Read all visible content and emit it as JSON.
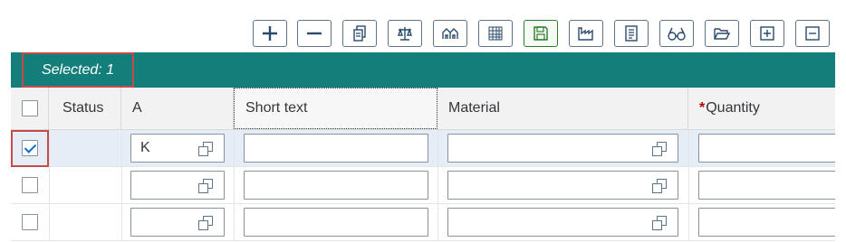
{
  "toolbar": {
    "buttons": [
      {
        "name": "add-row-button",
        "icon": "plus-icon"
      },
      {
        "name": "delete-row-button",
        "icon": "minus-icon"
      },
      {
        "name": "copy-button",
        "icon": "copy-icon"
      },
      {
        "name": "balance-button",
        "icon": "balance-scale-icon"
      },
      {
        "name": "buildings-button",
        "icon": "buildings-icon"
      },
      {
        "name": "table-button",
        "icon": "table-icon"
      },
      {
        "name": "save-button",
        "icon": "save-icon"
      },
      {
        "name": "factory-button",
        "icon": "factory-icon"
      },
      {
        "name": "document-button",
        "icon": "document-icon"
      },
      {
        "name": "display-button",
        "icon": "glasses-icon"
      },
      {
        "name": "open-folder-button",
        "icon": "folder-open-icon"
      },
      {
        "name": "expand-all-button",
        "icon": "expand-icon"
      },
      {
        "name": "collapse-all-button",
        "icon": "collapse-icon"
      }
    ]
  },
  "selection": {
    "label": "Selected: 1"
  },
  "table": {
    "columns": {
      "status": "Status",
      "a": "A",
      "short_text": "Short text",
      "material": "Material",
      "quantity_required_marker": "*",
      "quantity": "Quantity"
    },
    "rows": [
      {
        "selected": true,
        "status": "",
        "a": "K",
        "short_text": "",
        "material": "",
        "quantity": ""
      },
      {
        "selected": false,
        "status": "",
        "a": "",
        "short_text": "",
        "material": "",
        "quantity": ""
      },
      {
        "selected": false,
        "status": "",
        "a": "",
        "short_text": "",
        "material": "",
        "quantity": ""
      }
    ]
  },
  "colors": {
    "selection_bar": "#147f7a",
    "highlight_border": "#c64a4a",
    "selected_row": "#e5edf7",
    "required_star": "#bb0000"
  }
}
